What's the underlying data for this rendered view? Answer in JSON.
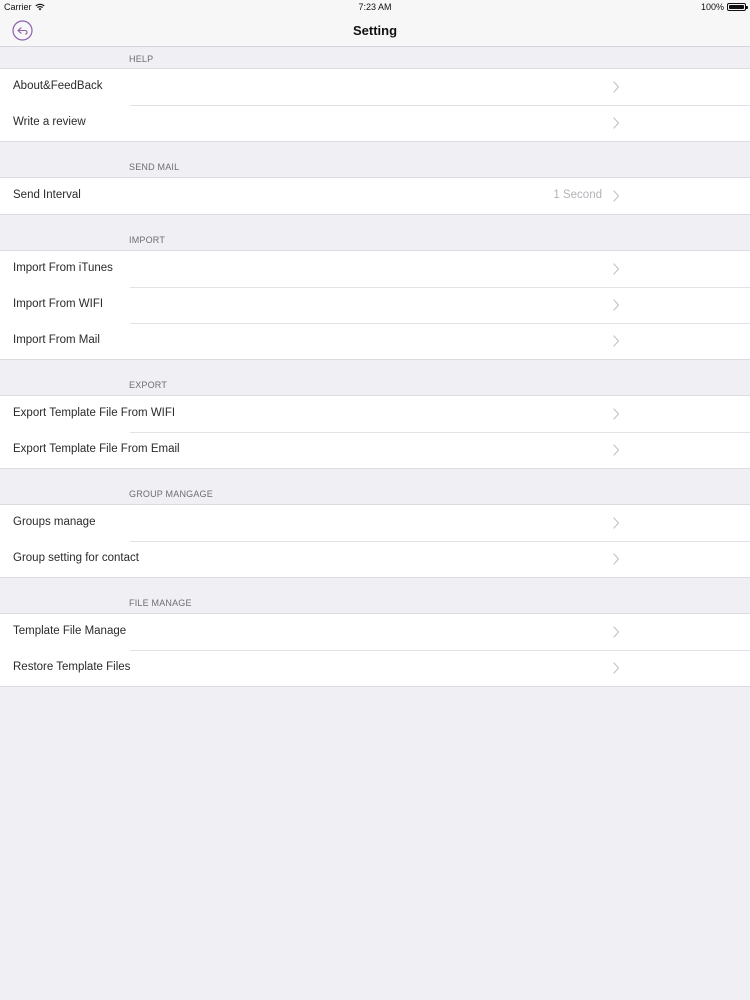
{
  "status_bar": {
    "carrier": "Carrier",
    "time": "7:23 AM",
    "battery": "100%",
    "battery_level": 1.0
  },
  "nav": {
    "title": "Setting",
    "back_icon": "back-circle-icon",
    "accent_color": "#8e5fb0"
  },
  "sections": [
    {
      "header": "HELP",
      "rows": [
        {
          "label": "About&FeedBack"
        },
        {
          "label": "Write a review"
        }
      ]
    },
    {
      "header": "SEND MAIL",
      "rows": [
        {
          "label": "Send Interval",
          "value": "1 Second"
        }
      ]
    },
    {
      "header": "IMPORT",
      "rows": [
        {
          "label": "Import From iTunes"
        },
        {
          "label": "Import From WIFI"
        },
        {
          "label": "Import From Mail"
        }
      ]
    },
    {
      "header": "EXPORT",
      "rows": [
        {
          "label": "Export Template File From WIFI"
        },
        {
          "label": "Export Template File From Email"
        }
      ]
    },
    {
      "header": "GROUP MANGAGE",
      "rows": [
        {
          "label": "Groups manage"
        },
        {
          "label": "Group setting for contact"
        }
      ]
    },
    {
      "header": "FILE MANAGE",
      "rows": [
        {
          "label": "Template File Manage"
        },
        {
          "label": "Restore Template Files"
        }
      ]
    }
  ]
}
